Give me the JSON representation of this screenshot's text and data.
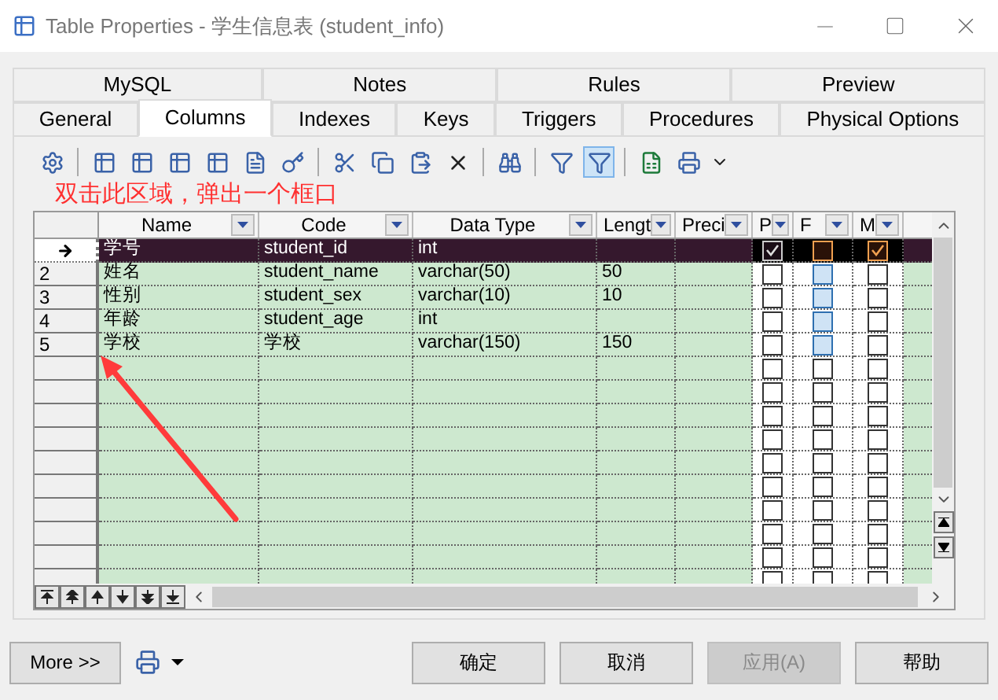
{
  "window": {
    "title": "Table Properties - 学生信息表 (student_info)"
  },
  "tab_rows": [
    [
      {
        "label": "MySQL",
        "selected": false
      },
      {
        "label": "Notes",
        "selected": false
      },
      {
        "label": "Rules",
        "selected": false
      },
      {
        "label": "Preview",
        "selected": false
      }
    ],
    [
      {
        "label": "General",
        "selected": false
      },
      {
        "label": "Columns",
        "selected": true
      },
      {
        "label": "Indexes",
        "selected": false
      },
      {
        "label": "Keys",
        "selected": false
      },
      {
        "label": "Triggers",
        "selected": false
      },
      {
        "label": "Procedures",
        "selected": false
      },
      {
        "label": "Physical Options",
        "selected": false
      }
    ]
  ],
  "annotation": {
    "text": "双击此区域，弹出一个框口"
  },
  "grid": {
    "columns": [
      {
        "label": "Name"
      },
      {
        "label": "Code"
      },
      {
        "label": "Data Type"
      },
      {
        "label": "Lengt"
      },
      {
        "label": "Preci"
      },
      {
        "label": "P"
      },
      {
        "label": "F"
      },
      {
        "label": "M"
      }
    ],
    "rows": [
      {
        "number": "",
        "current": true,
        "selected": true,
        "name": "学号",
        "code": "student_id",
        "data_type": "int",
        "length": "",
        "precision": "",
        "p": {
          "checked": true
        },
        "f": {
          "checked": false
        },
        "m": {
          "checked": true
        }
      },
      {
        "number": "2",
        "current": false,
        "selected": false,
        "name": "姓名",
        "code": "student_name",
        "data_type": "varchar(50)",
        "length": "50",
        "precision": "",
        "p": {
          "checked": false
        },
        "f": {
          "checked": false,
          "disabled": true
        },
        "m": {
          "checked": false
        }
      },
      {
        "number": "3",
        "current": false,
        "selected": false,
        "name": "性别",
        "code": "student_sex",
        "data_type": "varchar(10)",
        "length": "10",
        "precision": "",
        "p": {
          "checked": false
        },
        "f": {
          "checked": false,
          "disabled": true
        },
        "m": {
          "checked": false
        }
      },
      {
        "number": "4",
        "current": false,
        "selected": false,
        "name": "年龄",
        "code": "student_age",
        "data_type": "int",
        "length": "",
        "precision": "",
        "p": {
          "checked": false
        },
        "f": {
          "checked": false,
          "disabled": true
        },
        "m": {
          "checked": false
        }
      },
      {
        "number": "5",
        "current": false,
        "selected": false,
        "name": "学校",
        "code": "学校",
        "data_type": "varchar(150)",
        "length": "150",
        "precision": "",
        "p": {
          "checked": false
        },
        "f": {
          "checked": false,
          "disabled": true
        },
        "m": {
          "checked": false
        }
      }
    ],
    "blank_rows": [
      {
        "p": {
          "checked": false
        },
        "f": {
          "checked": false
        },
        "m": {
          "checked": false
        }
      },
      {
        "p": {
          "checked": false
        },
        "f": {
          "checked": false
        },
        "m": {
          "checked": false
        }
      },
      {
        "p": {
          "checked": false
        },
        "f": {
          "checked": false
        },
        "m": {
          "checked": false
        }
      },
      {
        "p": {
          "checked": false
        },
        "f": {
          "checked": false
        },
        "m": {
          "checked": false
        }
      },
      {
        "p": {
          "checked": false
        },
        "f": {
          "checked": false
        },
        "m": {
          "checked": false
        }
      },
      {
        "p": {
          "checked": false
        },
        "f": {
          "checked": false
        },
        "m": {
          "checked": false
        }
      },
      {
        "p": {
          "checked": false
        },
        "f": {
          "checked": false
        },
        "m": {
          "checked": false
        }
      },
      {
        "p": {
          "checked": false
        },
        "f": {
          "checked": false
        },
        "m": {
          "checked": false
        }
      },
      {
        "p": {
          "checked": false
        },
        "f": {
          "checked": false
        },
        "m": {
          "checked": false
        }
      },
      {
        "p": {
          "checked": false
        },
        "f": {
          "checked": false
        },
        "m": {
          "checked": false
        }
      }
    ]
  },
  "more_button": "More >>",
  "buttons": [
    {
      "label": "确定",
      "disabled": false
    },
    {
      "label": "取消",
      "disabled": false
    },
    {
      "label": "应用(A)",
      "disabled": true
    },
    {
      "label": "帮助",
      "disabled": false
    }
  ]
}
